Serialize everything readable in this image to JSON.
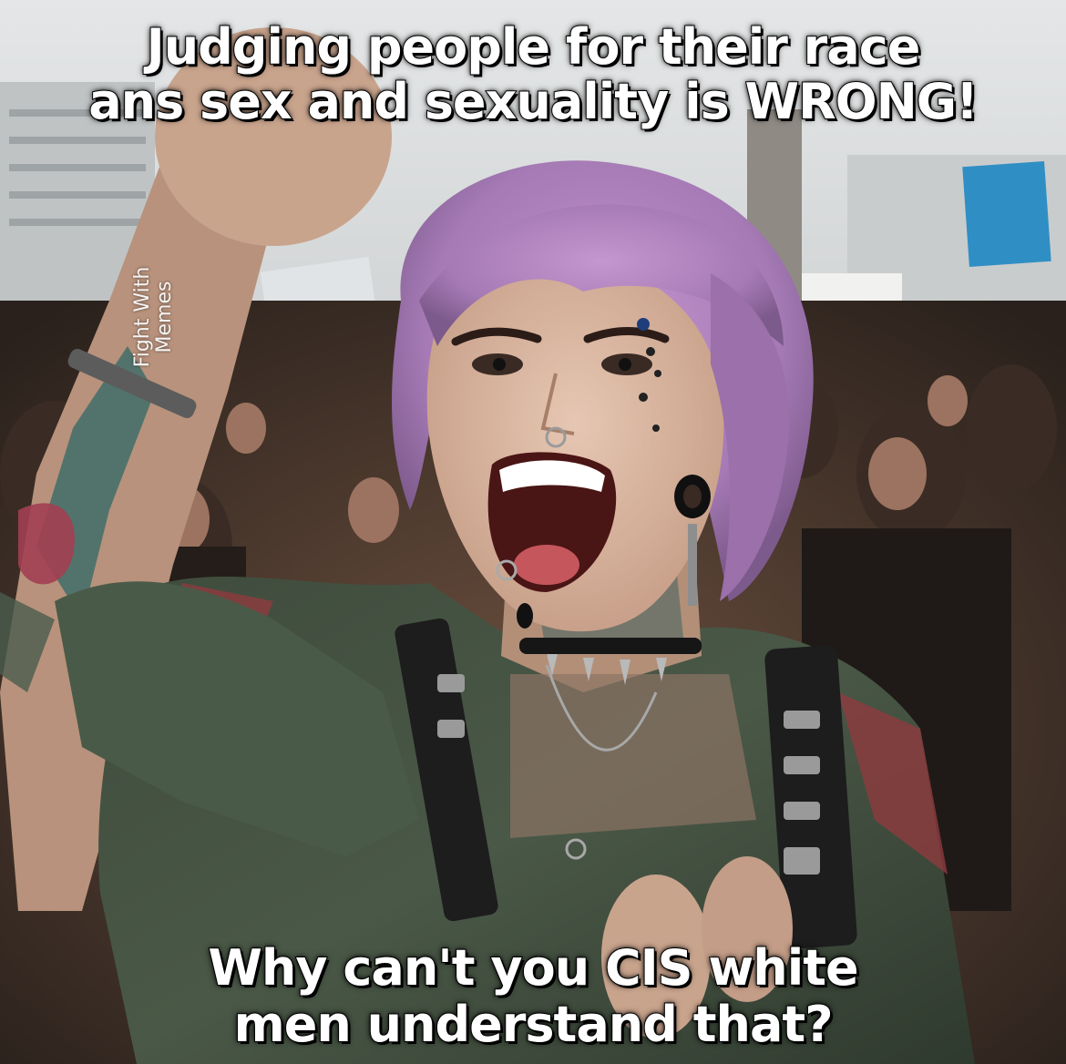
{
  "meme": {
    "top_caption": [
      "Judging people for their race",
      "ans sex and sexuality is WRONG!"
    ],
    "bottom_caption": [
      "Why can't you CIS white",
      "men understand that?"
    ],
    "watermark": [
      "Fight With",
      "Memes"
    ]
  },
  "palette": {
    "hair": "#a87ab8",
    "skin": "#d9b8a2",
    "shirt_green": "#3d4a3a",
    "flannel_red": "#8e3b3e",
    "crowd": "#5a4435",
    "sky": "#d7d9da"
  }
}
